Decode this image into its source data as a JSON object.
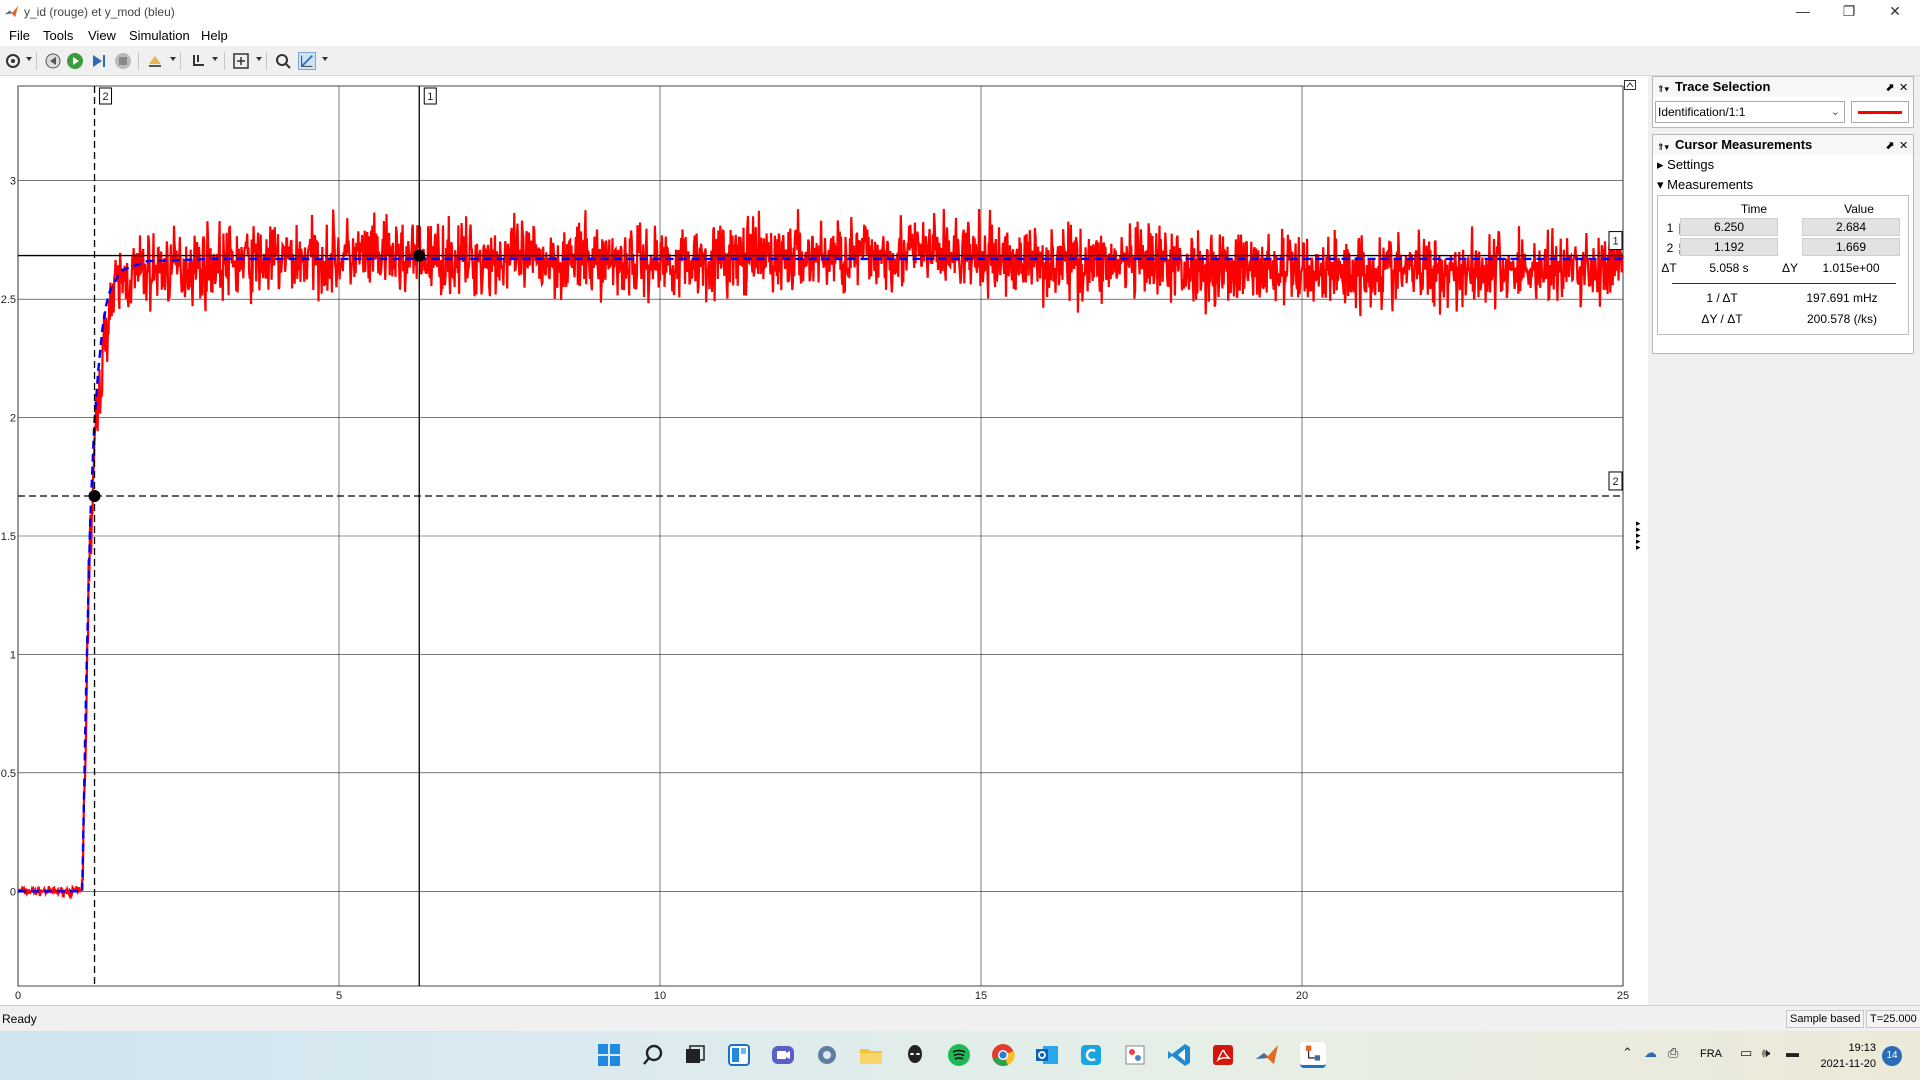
{
  "window": {
    "title": "y_id (rouge)  et y_mod (bleu)",
    "icon": "matlab-icon",
    "controls": {
      "minimize": "—",
      "restore": "❐",
      "close": "✕"
    }
  },
  "menu": [
    "File",
    "Tools",
    "View",
    "Simulation",
    "Help"
  ],
  "toolbar": {
    "icons": [
      "gear-icon",
      "step-back-icon",
      "run-icon",
      "step-forward-icon",
      "stop-icon",
      "highlight-icon",
      "zoom-icon",
      "fit-icon",
      "trigger-icon",
      "cursor-measure-icon"
    ]
  },
  "chart_data": {
    "type": "line",
    "title": "",
    "xlabel": "",
    "ylabel": "",
    "xlim": [
      0,
      25
    ],
    "ylim": [
      -0.4,
      3.4
    ],
    "x_ticks": [
      "0",
      "5",
      "10",
      "15",
      "20",
      "25"
    ],
    "y_ticks": [
      "0",
      "0.5",
      "1",
      "1.5",
      "2",
      "2.5",
      "3"
    ],
    "grid": true,
    "series": [
      {
        "name": "y_id",
        "color": "#ff0000",
        "style": "solid",
        "x": [
          0,
          0.5,
          1.0,
          1.05,
          1.1,
          1.2,
          1.3,
          1.4,
          1.6,
          2.0,
          3,
          5,
          10,
          14.5,
          15,
          20,
          25
        ],
        "y": [
          0,
          0,
          0,
          0.6,
          1.3,
          1.9,
          2.2,
          2.45,
          2.58,
          2.62,
          2.65,
          2.68,
          2.66,
          2.7,
          2.67,
          2.62,
          2.63
        ]
      },
      {
        "name": "y_mod",
        "color": "#0000ff",
        "style": "dashed",
        "x": [
          0,
          1.0,
          1.05,
          1.1,
          1.2,
          1.3,
          1.4,
          1.6,
          2.0,
          3,
          25
        ],
        "y": [
          0,
          0,
          0.7,
          1.4,
          2.05,
          2.35,
          2.52,
          2.62,
          2.66,
          2.67,
          2.67
        ]
      }
    ],
    "cursors": [
      {
        "label": "1",
        "time": 6.25,
        "value": 2.684,
        "style": "solid"
      },
      {
        "label": "2",
        "time": 1.192,
        "value": 1.669,
        "style": "dashed"
      }
    ]
  },
  "trace_selection": {
    "title": "Trace Selection",
    "selected": "Identification/1:1",
    "color": "#ff0000"
  },
  "cursor_measurements": {
    "title": "Cursor Measurements",
    "settings_label": "Settings",
    "measurements_label": "Measurements",
    "col_time": "Time",
    "col_value": "Value",
    "rows": [
      {
        "label": "1",
        "time": "6.250",
        "value": "2.684"
      },
      {
        "label": "2",
        "time": "1.192",
        "value": "1.669"
      }
    ],
    "dt_label": "ΔT",
    "dt_value": "5.058 s",
    "dy_label": "ΔY",
    "dy_value": "1.015e+00",
    "inv_dt_label": "1 / ΔT",
    "inv_dt_value": "197.691 mHz",
    "slope_label": "ΔY / ΔT",
    "slope_value": "200.578 (/ks)"
  },
  "status": {
    "left": "Ready",
    "sample_mode": "Sample based",
    "time": "T=25.000"
  },
  "taskbar": {
    "icons": [
      "windows-start-icon",
      "search-icon",
      "task-view-icon",
      "widgets-icon",
      "teams-icon",
      "settings-icon",
      "file-explorer-icon",
      "alienware-icon",
      "spotify-icon",
      "chrome-icon",
      "outlook-icon",
      "c-app-icon",
      "paint-icon",
      "vscode-icon",
      "acrobat-icon",
      "matlab-icon",
      "simulink-icon"
    ],
    "language": "FRA",
    "time": "19:13",
    "date": "2021-11-20",
    "notifications": "14"
  }
}
